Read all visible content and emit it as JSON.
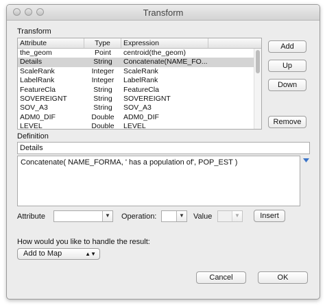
{
  "window": {
    "title": "Transform"
  },
  "transform_section": {
    "label": "Transform"
  },
  "table": {
    "headers": [
      "Attribute",
      "Type",
      "Expression"
    ],
    "rows": [
      {
        "attribute": "the_geom",
        "type": "Point",
        "expression": "centroid(the_geom)"
      },
      {
        "attribute": "Details",
        "type": "String",
        "expression": "Concatenate(NAME_FO..."
      },
      {
        "attribute": "ScaleRank",
        "type": "Integer",
        "expression": "ScaleRank"
      },
      {
        "attribute": "LabelRank",
        "type": "Integer",
        "expression": "LabelRank"
      },
      {
        "attribute": "FeatureCla",
        "type": "String",
        "expression": "FeatureCla"
      },
      {
        "attribute": "SOVEREIGNT",
        "type": "String",
        "expression": "SOVEREIGNT"
      },
      {
        "attribute": "SOV_A3",
        "type": "String",
        "expression": "SOV_A3"
      },
      {
        "attribute": "ADM0_DIF",
        "type": "Double",
        "expression": "ADM0_DIF"
      },
      {
        "attribute": "LEVEL",
        "type": "Double",
        "expression": "LEVEL"
      }
    ]
  },
  "side_buttons": {
    "add": "Add",
    "up": "Up",
    "down": "Down",
    "remove": "Remove"
  },
  "definition": {
    "label": "Definition",
    "name_value": "Details",
    "expression_value": "Concatenate( NAME_FORMA, ' has a population of', POP_EST )"
  },
  "builder": {
    "attribute_label": "Attribute",
    "operation_label": "Operation:",
    "value_label": "Value",
    "insert_button": "Insert"
  },
  "result": {
    "question": "How would you like to handle the result:",
    "selected": "Add to Map"
  },
  "footer": {
    "cancel": "Cancel",
    "ok": "OK"
  }
}
